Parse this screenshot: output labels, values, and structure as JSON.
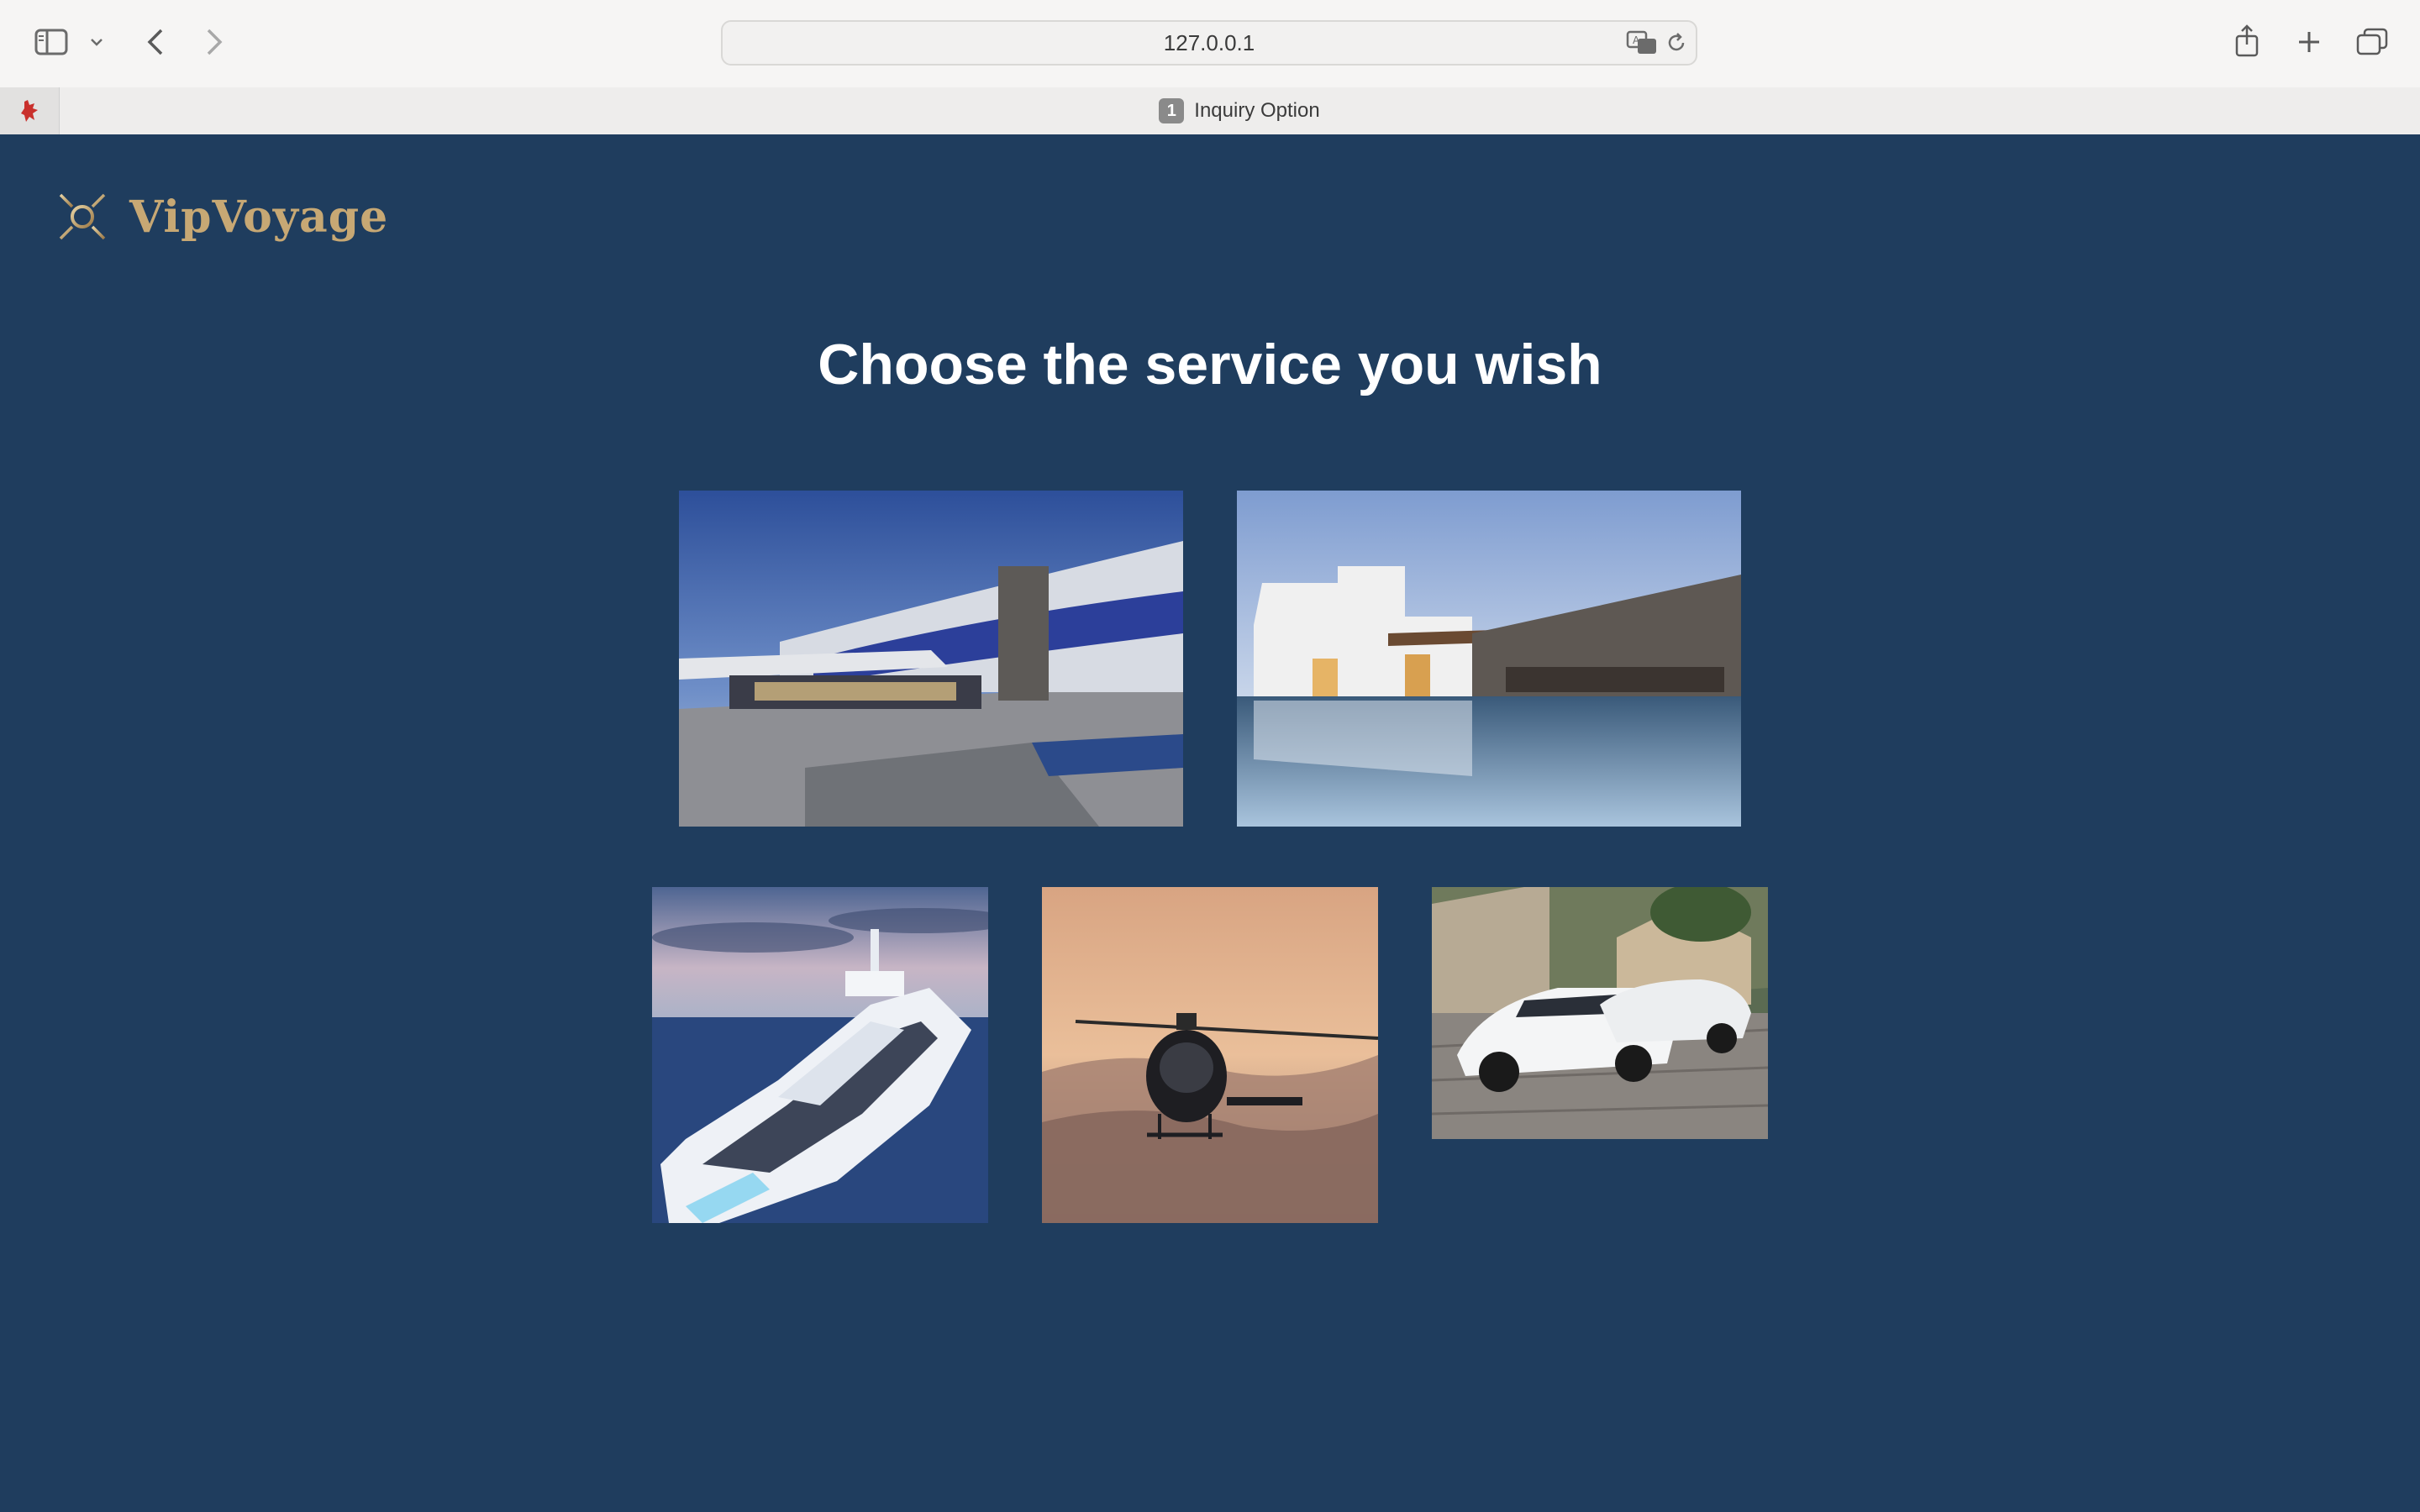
{
  "browser": {
    "url": "127.0.0.1",
    "tab": {
      "index": "1",
      "title": "Inquiry Option"
    },
    "icons": [
      "sidebar-icon",
      "chevron-down-icon",
      "back-icon",
      "forward-icon",
      "translate-icon",
      "reload-icon",
      "share-icon",
      "new-tab-icon",
      "tab-overview-icon"
    ]
  },
  "site": {
    "brand": "VipVoyage",
    "headline": "Choose the service you wish"
  },
  "services": [
    {
      "id": "hotel",
      "image": "hotel-photo"
    },
    {
      "id": "villa",
      "image": "villa-photo"
    },
    {
      "id": "yacht",
      "image": "yacht-photo"
    },
    {
      "id": "helicopter",
      "image": "helicopter-photo"
    },
    {
      "id": "car",
      "image": "car-photo"
    }
  ],
  "colors": {
    "background": "#1f3d5e",
    "brand_gold": "#c7a874",
    "headline": "#ffffff"
  }
}
